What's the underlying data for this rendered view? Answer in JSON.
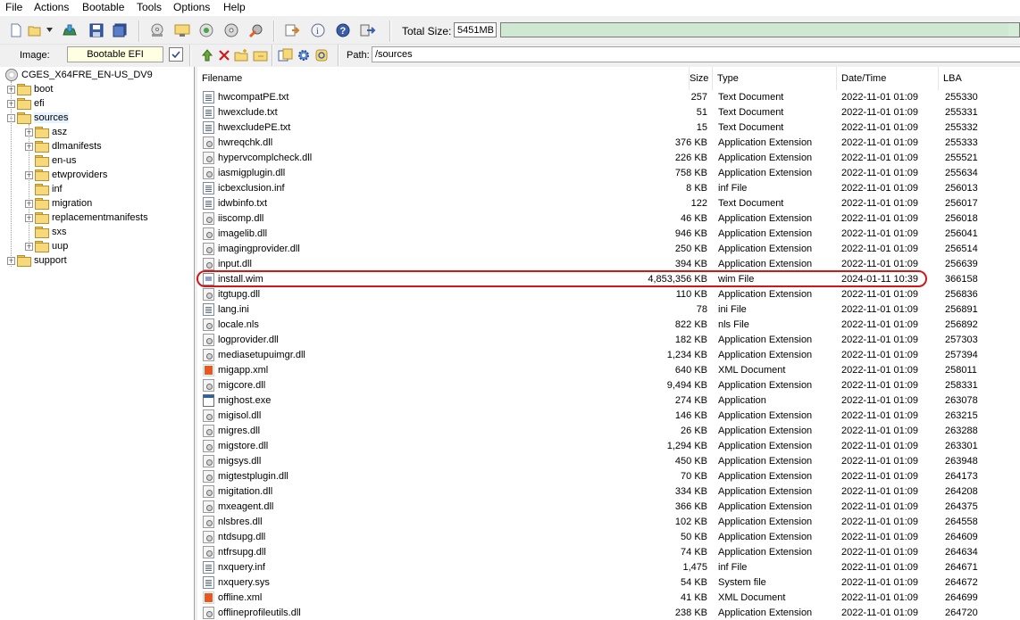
{
  "menu": [
    "File",
    "Actions",
    "Bootable",
    "Tools",
    "Options",
    "Help"
  ],
  "toolbar": {
    "buttons": [
      "new-icon",
      "open-icon",
      "open-dropdown-icon",
      "extract-icon",
      "save-icon",
      "save-as-icon",
      "cd-burn-icon",
      "mount-icon",
      "compress-icon",
      "checksum-icon",
      "settings-icon",
      "properties-icon",
      "info-icon",
      "help-icon",
      "exit-icon"
    ],
    "total_size_label": "Total Size:",
    "total_size_value": "5451MB",
    "total_size_fraction": 0.98
  },
  "image_bar": {
    "image_label": "Image:",
    "image_value": "Bootable EFI",
    "path_label": "Path:",
    "path_value": "/sources",
    "buttons": [
      "up-folder-icon",
      "delete-icon",
      "new-folder-icon",
      "rename-icon",
      "add-files-icon",
      "gear-icon",
      "refresh-icon"
    ]
  },
  "tree": {
    "root": "CGES_X64FRE_EN-US_DV9",
    "items": [
      {
        "label": "boot",
        "level": 1,
        "expander": "+"
      },
      {
        "label": "efi",
        "level": 1,
        "expander": "+"
      },
      {
        "label": "sources",
        "level": 1,
        "expander": "-",
        "selected": true
      },
      {
        "label": "asz",
        "level": 2,
        "expander": "+"
      },
      {
        "label": "dlmanifests",
        "level": 2,
        "expander": "+"
      },
      {
        "label": "en-us",
        "level": 2,
        "expander": ""
      },
      {
        "label": "etwproviders",
        "level": 2,
        "expander": "+"
      },
      {
        "label": "inf",
        "level": 2,
        "expander": ""
      },
      {
        "label": "migration",
        "level": 2,
        "expander": "+"
      },
      {
        "label": "replacementmanifests",
        "level": 2,
        "expander": "+"
      },
      {
        "label": "sxs",
        "level": 2,
        "expander": ""
      },
      {
        "label": "uup",
        "level": 2,
        "expander": "+"
      },
      {
        "label": "support",
        "level": 1,
        "expander": "+"
      }
    ]
  },
  "list": {
    "columns": [
      "Filename",
      "Size",
      "Type",
      "Date/Time",
      "LBA"
    ],
    "rows": [
      {
        "icon": "txt",
        "name": "hwcompatPE.txt",
        "size": "257",
        "type": "Text Document",
        "date": "2022-11-01 01:09",
        "lba": "255330"
      },
      {
        "icon": "txt",
        "name": "hwexclude.txt",
        "size": "51",
        "type": "Text Document",
        "date": "2022-11-01 01:09",
        "lba": "255331"
      },
      {
        "icon": "txt",
        "name": "hwexcludePE.txt",
        "size": "15",
        "type": "Text Document",
        "date": "2022-11-01 01:09",
        "lba": "255332"
      },
      {
        "icon": "dll",
        "name": "hwreqchk.dll",
        "size": "376 KB",
        "type": "Application Extension",
        "date": "2022-11-01 01:09",
        "lba": "255333"
      },
      {
        "icon": "dll",
        "name": "hypervcomplcheck.dll",
        "size": "226 KB",
        "type": "Application Extension",
        "date": "2022-11-01 01:09",
        "lba": "255521"
      },
      {
        "icon": "dll",
        "name": "iasmigplugin.dll",
        "size": "758 KB",
        "type": "Application Extension",
        "date": "2022-11-01 01:09",
        "lba": "255634"
      },
      {
        "icon": "txt",
        "name": "icbexclusion.inf",
        "size": "8 KB",
        "type": "inf File",
        "date": "2022-11-01 01:09",
        "lba": "256013"
      },
      {
        "icon": "txt",
        "name": "idwbinfo.txt",
        "size": "122",
        "type": "Text Document",
        "date": "2022-11-01 01:09",
        "lba": "256017"
      },
      {
        "icon": "dll",
        "name": "iiscomp.dll",
        "size": "46 KB",
        "type": "Application Extension",
        "date": "2022-11-01 01:09",
        "lba": "256018"
      },
      {
        "icon": "dll",
        "name": "imagelib.dll",
        "size": "946 KB",
        "type": "Application Extension",
        "date": "2022-11-01 01:09",
        "lba": "256041"
      },
      {
        "icon": "dll",
        "name": "imagingprovider.dll",
        "size": "250 KB",
        "type": "Application Extension",
        "date": "2022-11-01 01:09",
        "lba": "256514"
      },
      {
        "icon": "dll",
        "name": "input.dll",
        "size": "394 KB",
        "type": "Application Extension",
        "date": "2022-11-01 01:09",
        "lba": "256639"
      },
      {
        "icon": "wim",
        "name": "install.wim",
        "size": "4,853,356 KB",
        "type": "wim File",
        "date": "2024-01-11 10:39",
        "lba": "366158",
        "highlighted": true
      },
      {
        "icon": "dll",
        "name": "itgtupg.dll",
        "size": "110 KB",
        "type": "Application Extension",
        "date": "2022-11-01 01:09",
        "lba": "256836"
      },
      {
        "icon": "txt",
        "name": "lang.ini",
        "size": "78",
        "type": "ini File",
        "date": "2022-11-01 01:09",
        "lba": "256891"
      },
      {
        "icon": "dll",
        "name": "locale.nls",
        "size": "822 KB",
        "type": "nls File",
        "date": "2022-11-01 01:09",
        "lba": "256892"
      },
      {
        "icon": "dll",
        "name": "logprovider.dll",
        "size": "182 KB",
        "type": "Application Extension",
        "date": "2022-11-01 01:09",
        "lba": "257303"
      },
      {
        "icon": "dll",
        "name": "mediasetupuimgr.dll",
        "size": "1,234 KB",
        "type": "Application Extension",
        "date": "2022-11-01 01:09",
        "lba": "257394"
      },
      {
        "icon": "xml",
        "name": "migapp.xml",
        "size": "640 KB",
        "type": "XML Document",
        "date": "2022-11-01 01:09",
        "lba": "258011"
      },
      {
        "icon": "dll",
        "name": "migcore.dll",
        "size": "9,494 KB",
        "type": "Application Extension",
        "date": "2022-11-01 01:09",
        "lba": "258331"
      },
      {
        "icon": "exe",
        "name": "mighost.exe",
        "size": "274 KB",
        "type": "Application",
        "date": "2022-11-01 01:09",
        "lba": "263078"
      },
      {
        "icon": "dll",
        "name": "migisol.dll",
        "size": "146 KB",
        "type": "Application Extension",
        "date": "2022-11-01 01:09",
        "lba": "263215"
      },
      {
        "icon": "dll",
        "name": "migres.dll",
        "size": "26 KB",
        "type": "Application Extension",
        "date": "2022-11-01 01:09",
        "lba": "263288"
      },
      {
        "icon": "dll",
        "name": "migstore.dll",
        "size": "1,294 KB",
        "type": "Application Extension",
        "date": "2022-11-01 01:09",
        "lba": "263301"
      },
      {
        "icon": "dll",
        "name": "migsys.dll",
        "size": "450 KB",
        "type": "Application Extension",
        "date": "2022-11-01 01:09",
        "lba": "263948"
      },
      {
        "icon": "dll",
        "name": "migtestplugin.dll",
        "size": "70 KB",
        "type": "Application Extension",
        "date": "2022-11-01 01:09",
        "lba": "264173"
      },
      {
        "icon": "dll",
        "name": "migitation.dll",
        "size": "334 KB",
        "type": "Application Extension",
        "date": "2022-11-01 01:09",
        "lba": "264208"
      },
      {
        "icon": "dll",
        "name": "mxeagent.dll",
        "size": "366 KB",
        "type": "Application Extension",
        "date": "2022-11-01 01:09",
        "lba": "264375"
      },
      {
        "icon": "dll",
        "name": "nlsbres.dll",
        "size": "102 KB",
        "type": "Application Extension",
        "date": "2022-11-01 01:09",
        "lba": "264558"
      },
      {
        "icon": "dll",
        "name": "ntdsupg.dll",
        "size": "50 KB",
        "type": "Application Extension",
        "date": "2022-11-01 01:09",
        "lba": "264609"
      },
      {
        "icon": "dll",
        "name": "ntfrsupg.dll",
        "size": "74 KB",
        "type": "Application Extension",
        "date": "2022-11-01 01:09",
        "lba": "264634"
      },
      {
        "icon": "txt",
        "name": "nxquery.inf",
        "size": "1,475",
        "type": "inf File",
        "date": "2022-11-01 01:09",
        "lba": "264671"
      },
      {
        "icon": "txt",
        "name": "nxquery.sys",
        "size": "54 KB",
        "type": "System file",
        "date": "2022-11-01 01:09",
        "lba": "264672"
      },
      {
        "icon": "xml",
        "name": "offline.xml",
        "size": "41 KB",
        "type": "XML Document",
        "date": "2022-11-01 01:09",
        "lba": "264699"
      },
      {
        "icon": "dll",
        "name": "offlineprofileutils.dll",
        "size": "238 KB",
        "type": "Application Extension",
        "date": "2022-11-01 01:09",
        "lba": "264720"
      }
    ]
  },
  "colors": {
    "highlight_ring": "#d01818",
    "total_size_fill": "#cfe8d2",
    "image_field_bg": "#ffffe1"
  }
}
